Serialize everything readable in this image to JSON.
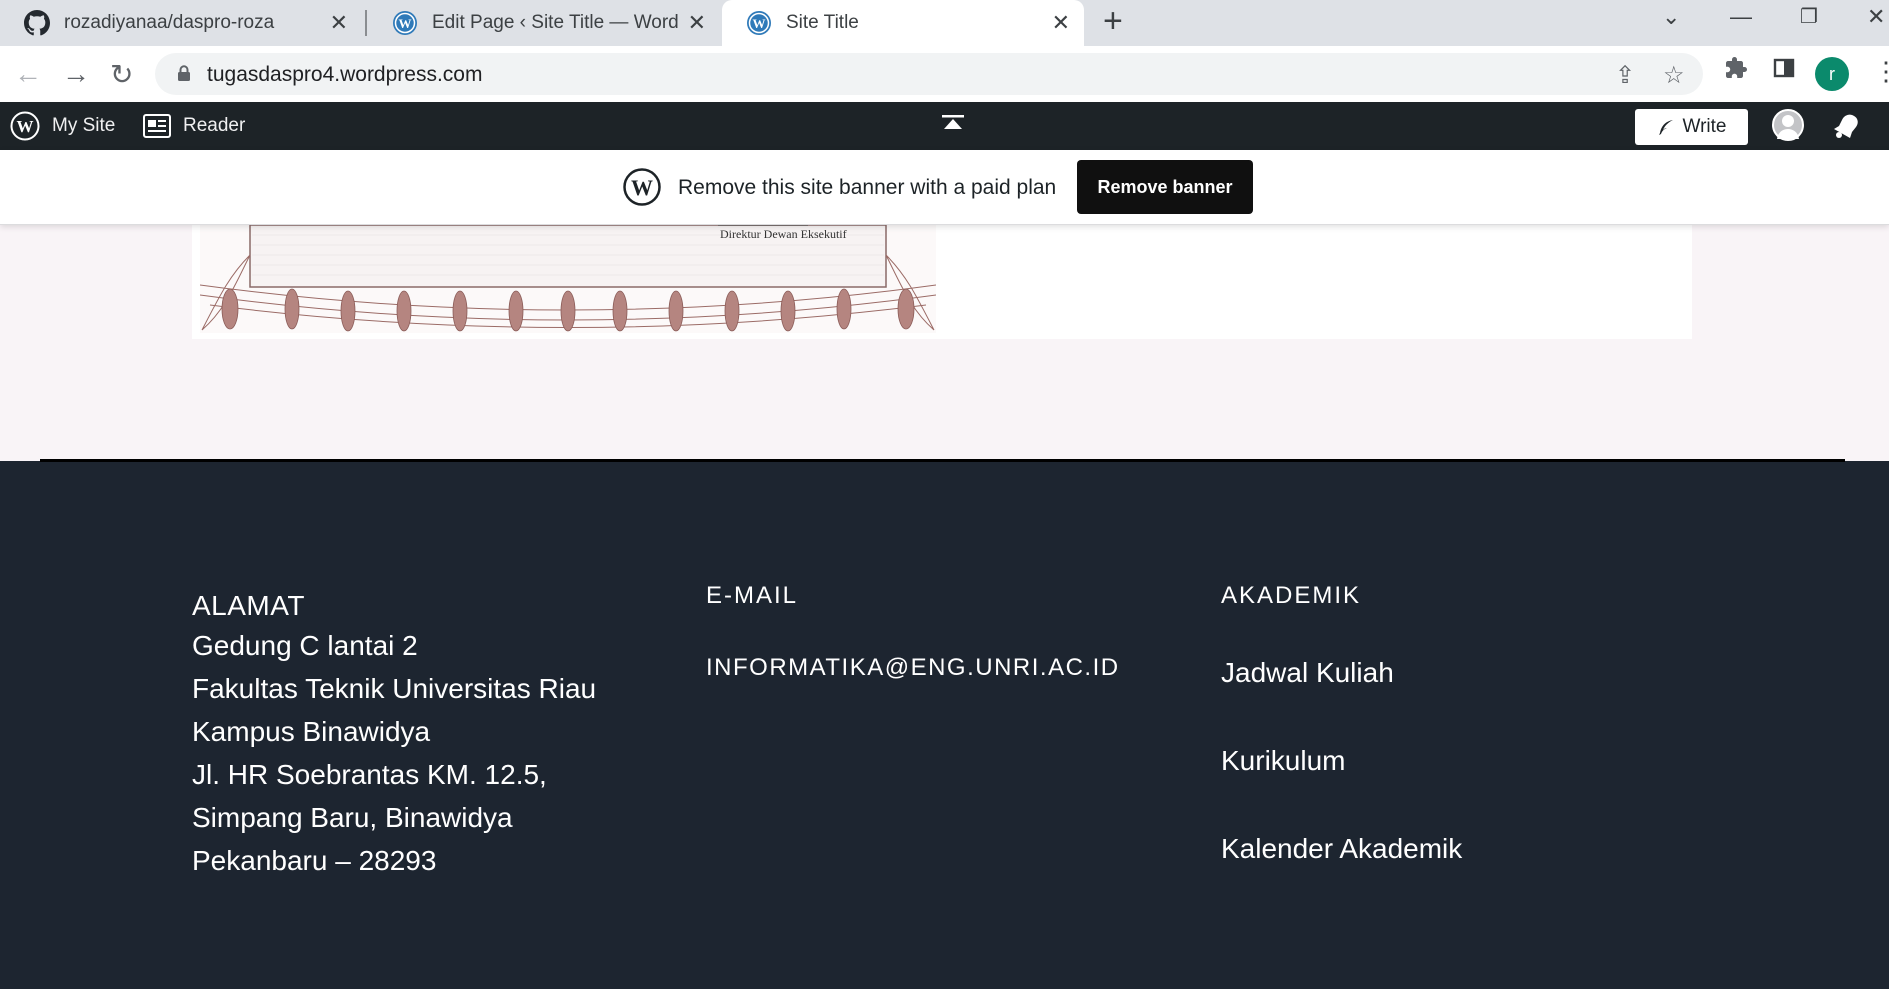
{
  "browser": {
    "tabs": [
      {
        "title": "rozadiyanaa/daspro-roza",
        "icon": "github-icon"
      },
      {
        "title": "Edit Page ‹ Site Title — WordPress",
        "icon": "wordpress-icon"
      },
      {
        "title": "Site Title",
        "icon": "wordpress-icon"
      }
    ],
    "url": "tugasdaspro4.wordpress.com",
    "profile_initial": "r"
  },
  "adminbar": {
    "my_site": "My Site",
    "reader": "Reader",
    "write": "Write"
  },
  "banner": {
    "text": "Remove this site banner with a paid plan",
    "button": "Remove banner"
  },
  "certificate": {
    "signature_title": "Direktur Dewan Eksekutif"
  },
  "footer": {
    "alamat": {
      "heading": "ALAMAT",
      "lines": [
        "Gedung C lantai 2",
        "Fakultas Teknik Universitas Riau",
        "Kampus Binawidya",
        "Jl. HR Soebrantas KM. 12.5,",
        "Simpang Baru, Binawidya",
        "Pekanbaru – 28293"
      ]
    },
    "email": {
      "heading": "E-MAIL",
      "address": "INFORMATIKA@ENG.UNRI.AC.ID"
    },
    "akademik": {
      "heading": "AKADEMIK",
      "links": [
        "Jadwal Kuliah",
        "Kurikulum",
        "Kalender Akademik"
      ]
    }
  },
  "colors": {
    "footer_bg": "#1d2530",
    "adminbar_bg": "#1d2327",
    "content_bg": "#f9f4f7",
    "banner_button": "#101010"
  }
}
